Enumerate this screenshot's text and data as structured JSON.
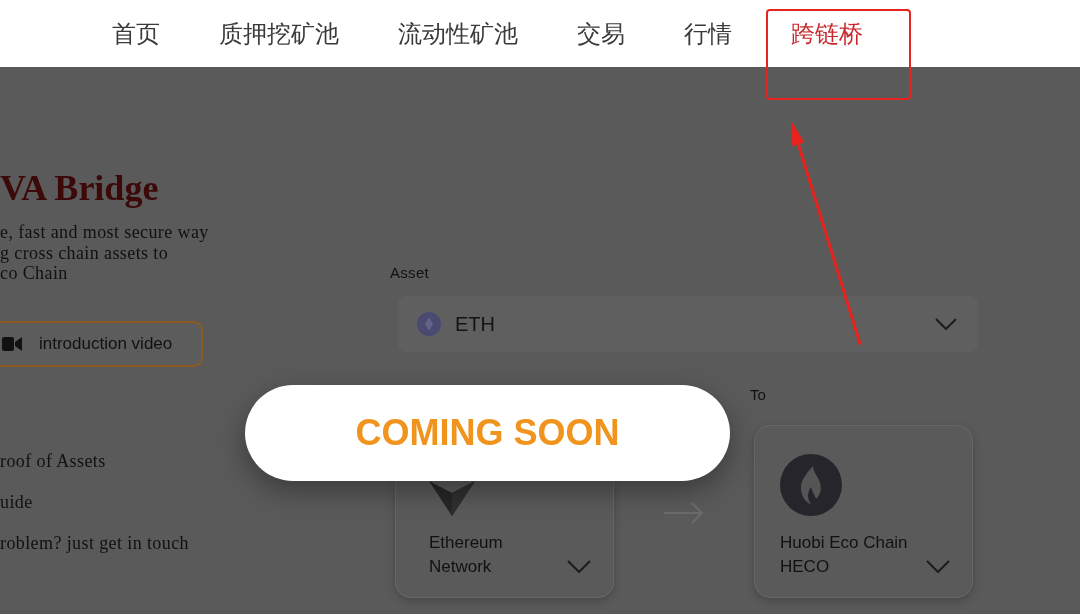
{
  "nav": {
    "items": [
      {
        "label": "首页",
        "selected": false,
        "highlighted": false
      },
      {
        "label": "质押挖矿池",
        "selected": false,
        "highlighted": false
      },
      {
        "label": "流动性矿池",
        "selected": false,
        "highlighted": false
      },
      {
        "label": "交易",
        "selected": false,
        "highlighted": false
      },
      {
        "label": "行情",
        "selected": false,
        "highlighted": false
      },
      {
        "label": "跨链桥",
        "selected": true,
        "highlighted": true
      }
    ]
  },
  "intro": {
    "title": "VA Bridge",
    "description_lines": [
      "e, fast and most secure way",
      "g cross chain assets to",
      "co Chain"
    ],
    "video_button": "introduction video"
  },
  "links": [
    "roof of Assets",
    "uide",
    "roblem? just get in touch"
  ],
  "bridge_form": {
    "asset_label": "Asset",
    "asset": "ETH",
    "to_label": "To",
    "from_network": "Ethereum Network",
    "to_network": {
      "name": "Huobi Eco Chain",
      "code": "HECO"
    }
  },
  "notice": {
    "text": "COMING SOON"
  }
}
